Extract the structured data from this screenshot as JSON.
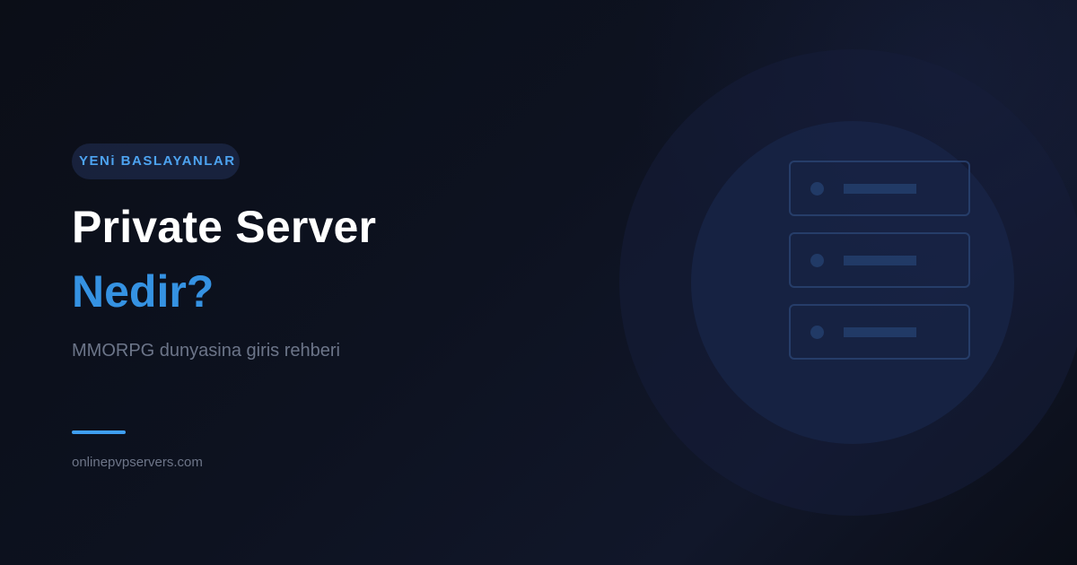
{
  "badge": {
    "label": "YENi BASLAYANLAR"
  },
  "title": {
    "line1": "Private Server",
    "line2": "Nedir?"
  },
  "subtitle": "MMORPG dunyasina giris rehberi",
  "site": "onlinepvpservers.com",
  "illustration": {
    "icon": "server-rack-icon",
    "units": 3
  },
  "colors": {
    "background": "#0d1220",
    "accent": "#3592e2",
    "badge_text": "#4da3f0",
    "title": "#ffffff",
    "muted": "#6c7589"
  }
}
